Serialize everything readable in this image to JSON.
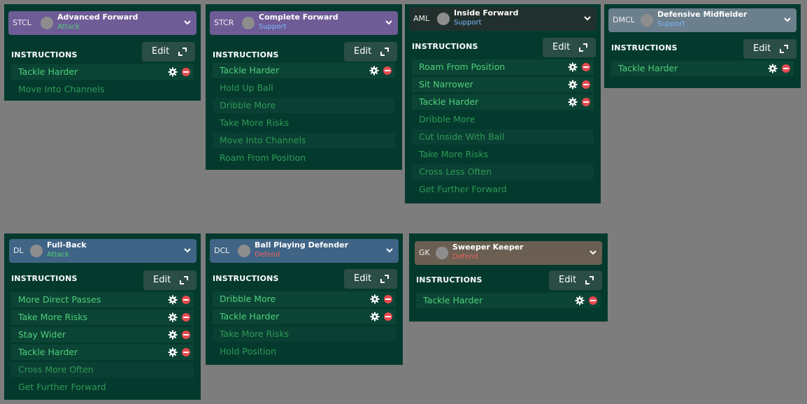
{
  "common": {
    "instructions_label": "INSTRUCTIONS",
    "edit_label": "Edit"
  },
  "cards": [
    {
      "position": "STCL",
      "role": "Advanced Forward",
      "duty": "Attack",
      "instructions": [
        {
          "label": "Tackle Harder",
          "active": true
        },
        {
          "label": "Move Into Channels",
          "active": false
        }
      ]
    },
    {
      "position": "STCR",
      "role": "Complete Forward",
      "duty": "Support",
      "instructions": [
        {
          "label": "Tackle Harder",
          "active": true
        },
        {
          "label": "Hold Up Ball",
          "active": false
        },
        {
          "label": "Dribble More",
          "active": false
        },
        {
          "label": "Take More Risks",
          "active": false
        },
        {
          "label": "Move Into Channels",
          "active": false
        },
        {
          "label": "Roam From Position",
          "active": false
        }
      ]
    },
    {
      "position": "AML",
      "role": "Inside Forward",
      "duty": "Support",
      "instructions": [
        {
          "label": "Roam From Position",
          "active": true
        },
        {
          "label": "Sit Narrower",
          "active": true
        },
        {
          "label": "Tackle Harder",
          "active": true
        },
        {
          "label": "Dribble More",
          "active": false
        },
        {
          "label": "Cut Inside With Ball",
          "active": false
        },
        {
          "label": "Take More Risks",
          "active": false
        },
        {
          "label": "Cross Less Often",
          "active": false
        },
        {
          "label": "Get Further Forward",
          "active": false
        }
      ]
    },
    {
      "position": "DMCL",
      "role": "Defensive Midfielder",
      "duty": "Support",
      "instructions": [
        {
          "label": "Tackle Harder",
          "active": true
        }
      ]
    },
    {
      "position": "DL",
      "role": "Full-Back",
      "duty": "Attack",
      "instructions": [
        {
          "label": "More Direct Passes",
          "active": true
        },
        {
          "label": "Take More Risks",
          "active": true
        },
        {
          "label": "Stay Wider",
          "active": true
        },
        {
          "label": "Tackle Harder",
          "active": true
        },
        {
          "label": "Cross More Often",
          "active": false
        },
        {
          "label": "Get Further Forward",
          "active": false
        }
      ]
    },
    {
      "position": "DCL",
      "role": "Ball Playing Defender",
      "duty": "Defend",
      "instructions": [
        {
          "label": "Dribble More",
          "active": true
        },
        {
          "label": "Tackle Harder",
          "active": true
        },
        {
          "label": "Take More Risks",
          "active": false
        },
        {
          "label": "Hold Position",
          "active": false
        }
      ]
    },
    {
      "position": "GK",
      "role": "Sweeper Keeper",
      "duty": "Defend",
      "instructions": [
        {
          "label": "Tackle Harder",
          "active": true
        }
      ]
    }
  ],
  "colors": {
    "attack": "#4fd07a",
    "support": "#7ab6ff",
    "defend": "#f0605a",
    "header_attack": "#6e5c96",
    "header_support": "#6e5c96",
    "header_inside": "#22302d",
    "header_dm": "#6c7f8c",
    "header_def": "#3f6485",
    "header_gk": "#6a5f52"
  }
}
